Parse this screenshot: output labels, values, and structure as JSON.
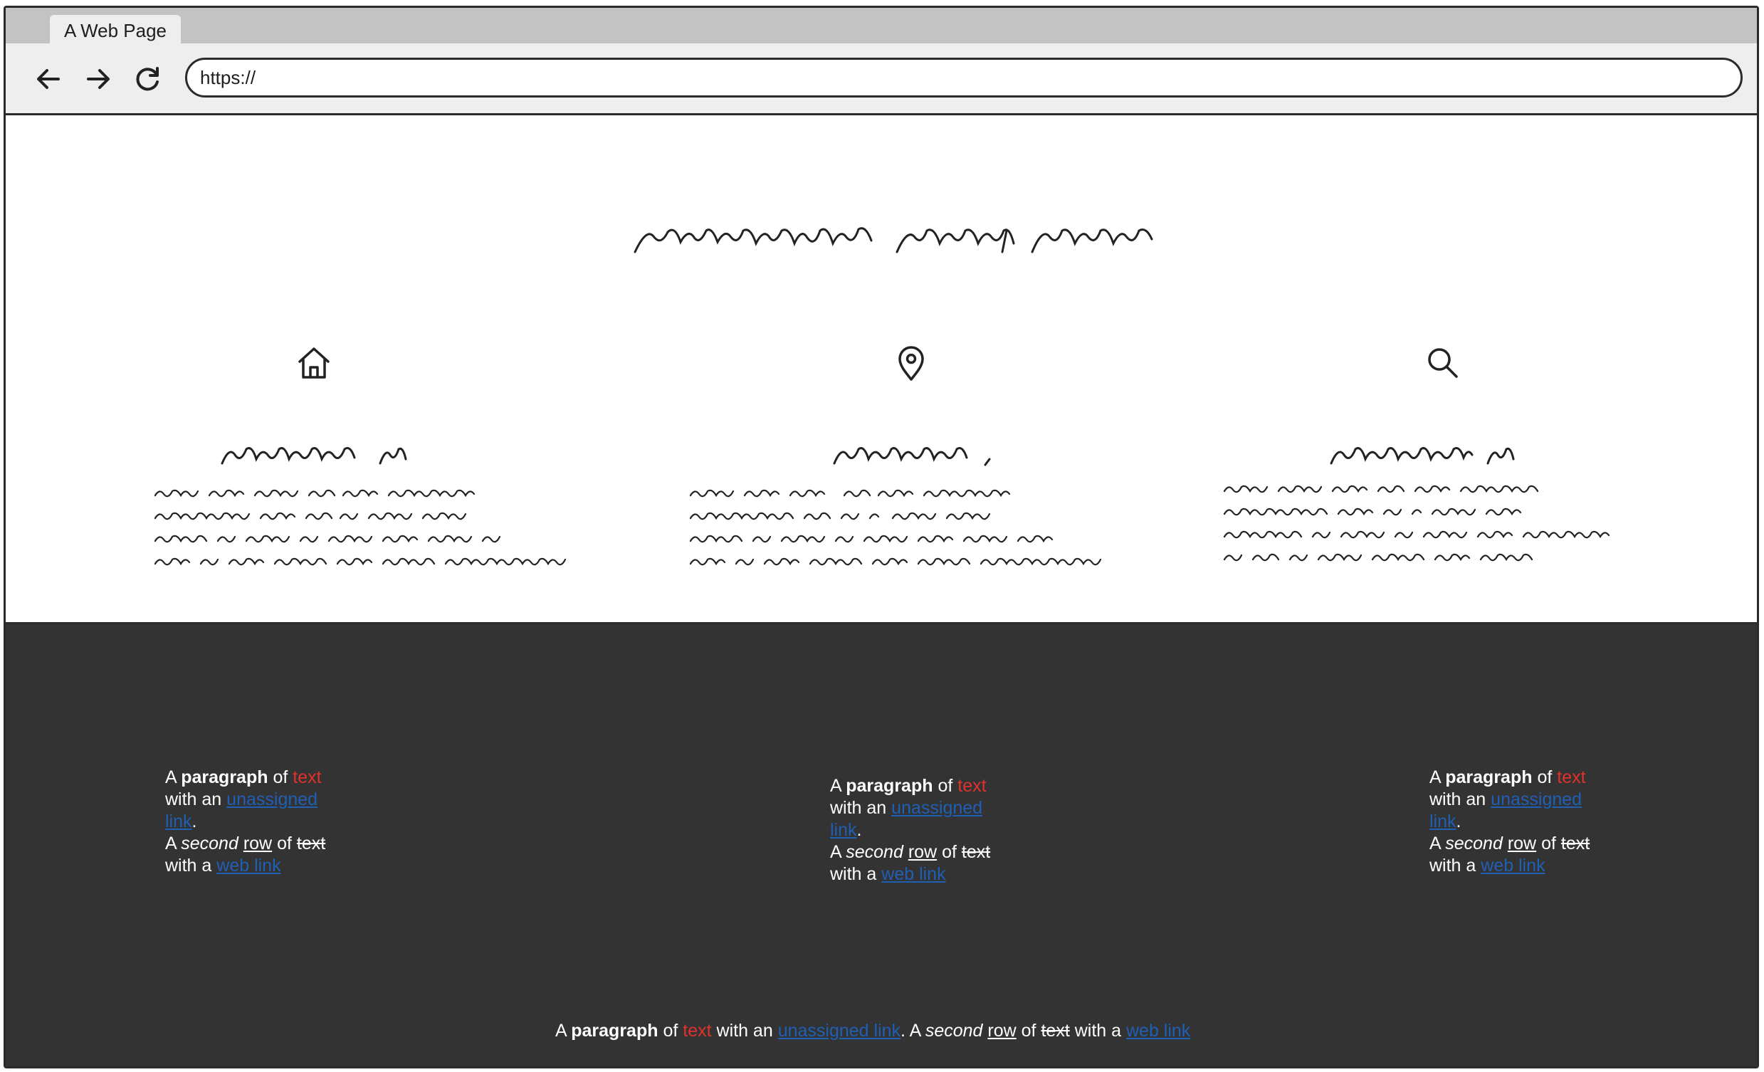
{
  "browser": {
    "tab_title": "A Web Page",
    "url": "https://",
    "icons": {
      "back": "arrow-left-icon",
      "forward": "arrow-right-icon",
      "reload": "reload-icon"
    }
  },
  "features": [
    {
      "icon": "home-icon"
    },
    {
      "icon": "map-pin-icon"
    },
    {
      "icon": "search-icon"
    }
  ],
  "footer": {
    "paragraph": {
      "w1": "A",
      "bold": "paragraph",
      "w2": "of",
      "red": "text",
      "w3": "with an",
      "link1": "unassigned link",
      "period": ".",
      "w4": "A",
      "italic": "second",
      "underlined": "row",
      "w5": "of",
      "strike": "text",
      "w6": "with a",
      "link2": "web link"
    }
  },
  "colors": {
    "footer_bg": "#333333",
    "highlight_red": "#e0312c",
    "link_blue": "#1f5fb4",
    "chrome_gray": "#c3c3c3"
  }
}
